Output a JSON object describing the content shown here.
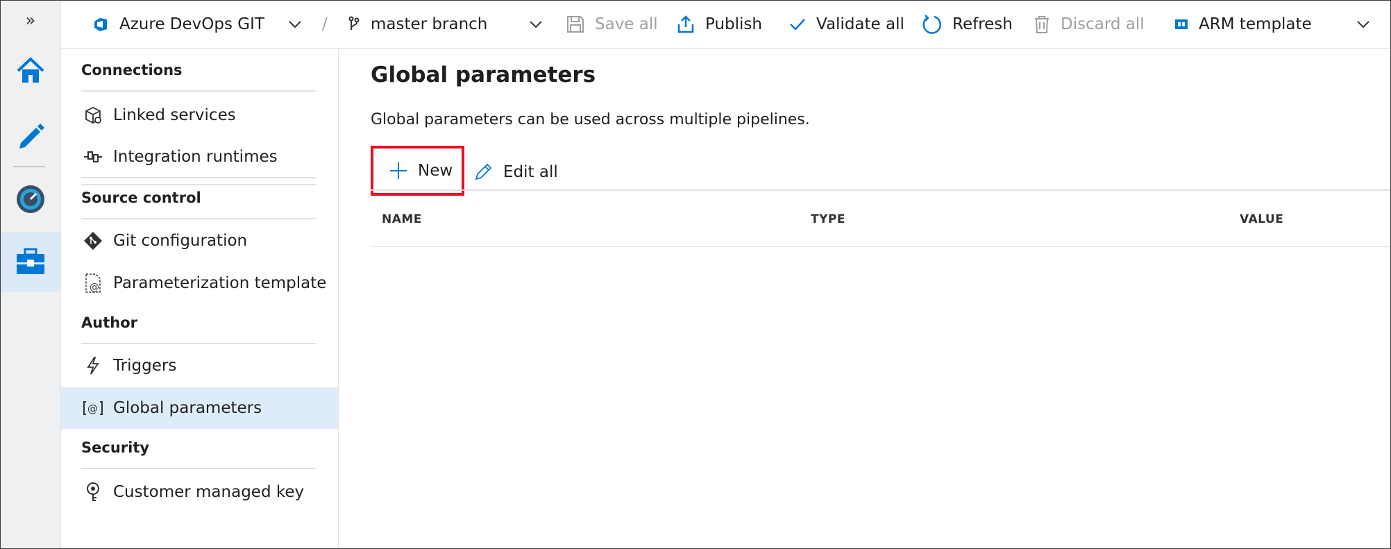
{
  "toolbar": {
    "repo_label": "Azure DevOps GIT",
    "separator": "/",
    "branch_label": "master branch",
    "save_all_label": "Save all",
    "publish_label": "Publish",
    "validate_all_label": "Validate all",
    "refresh_label": "Refresh",
    "discard_all_label": "Discard all",
    "arm_template_label": "ARM template"
  },
  "rail": {
    "expand_glyph": "»",
    "items": [
      "home-icon",
      "pencil-icon",
      "monitor-icon",
      "toolbox-icon"
    ],
    "active_item": "toolbox-icon"
  },
  "nav": {
    "sections": [
      {
        "label": "Connections",
        "items": [
          {
            "label": "Linked services",
            "icon": "linked-services-icon"
          },
          {
            "label": "Integration runtimes",
            "icon": "integration-runtime-icon"
          }
        ]
      },
      {
        "label": "Source control",
        "items": [
          {
            "label": "Git configuration",
            "icon": "git-icon"
          },
          {
            "label": "Parameterization template",
            "icon": "parameterization-template-icon"
          }
        ]
      },
      {
        "label": "Author",
        "items": [
          {
            "label": "Triggers",
            "icon": "trigger-icon"
          },
          {
            "label": "Global parameters",
            "icon": "global-parameters-icon"
          }
        ]
      },
      {
        "label": "Security",
        "items": [
          {
            "label": "Customer managed key",
            "icon": "key-icon"
          }
        ]
      }
    ],
    "selected": "Global parameters"
  },
  "content": {
    "title": "Global parameters",
    "description": "Global parameters can be used across multiple pipelines.",
    "new_label": "New",
    "edit_all_label": "Edit all",
    "columns": [
      "NAME",
      "TYPE",
      "VALUE"
    ],
    "rows": []
  },
  "colors": {
    "accent": "#0078d4",
    "highlight_border": "#e81123",
    "selected_bg": "#deecf9"
  }
}
